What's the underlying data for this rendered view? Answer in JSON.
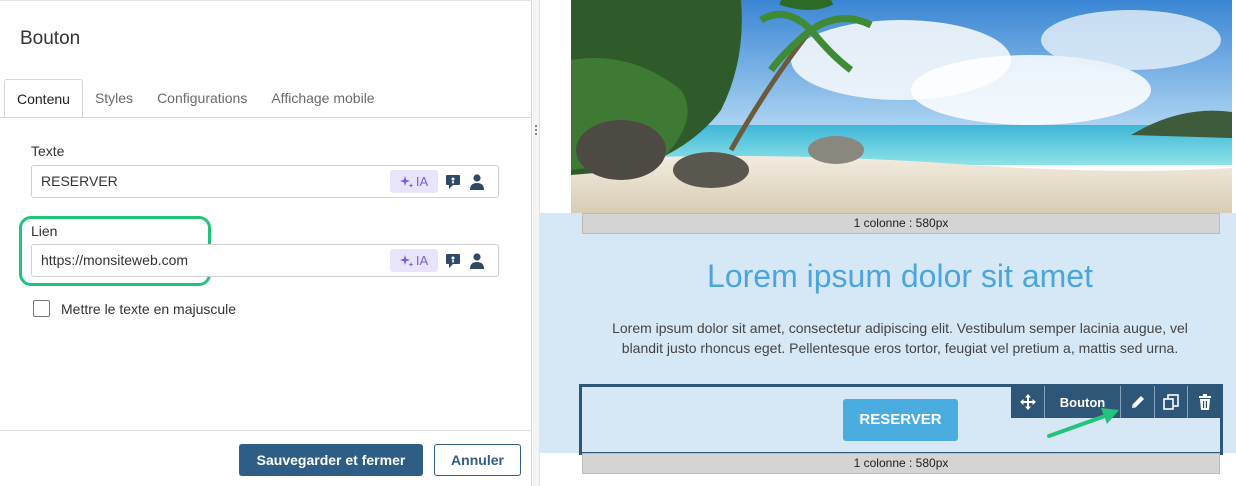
{
  "panel": {
    "title": "Bouton",
    "tabs": [
      {
        "label": "Contenu"
      },
      {
        "label": "Styles"
      },
      {
        "label": "Configurations"
      },
      {
        "label": "Affichage mobile"
      }
    ],
    "text_field": {
      "label": "Texte",
      "value": "RESERVER",
      "ia_label": "IA"
    },
    "link_field": {
      "label": "Lien",
      "value": "https://monsiteweb.com",
      "ia_label": "IA"
    },
    "uppercase_checkbox": {
      "label": "Mettre le texte en majuscule",
      "checked": false
    },
    "save_label": "Sauvegarder et fermer",
    "cancel_label": "Annuler"
  },
  "preview": {
    "column_label_top": "1 colonne : 580px",
    "column_label_bottom": "1 colonne : 580px",
    "headline": "Lorem ipsum dolor sit amet",
    "paragraph": "Lorem ipsum dolor sit amet, consectetur adipiscing elit. Vestibulum semper lacinia augue, vel blandit justo rhoncus eget. Pellentesque eros tortor, feugiat vel pretium a, mattis sed urna.",
    "button_label": "RESERVER",
    "toolbar_label": "Bouton"
  },
  "colors": {
    "primary": "#2e5d85",
    "headline": "#4aa6dc",
    "highlight": "#22c47b",
    "ia": "#7b5fd6"
  },
  "icons": [
    "move-icon",
    "edit-pencil-icon",
    "duplicate-icon",
    "trash-icon",
    "sparkle-icon",
    "merge-tag-icon",
    "user-icon",
    "annotation-arrow"
  ]
}
